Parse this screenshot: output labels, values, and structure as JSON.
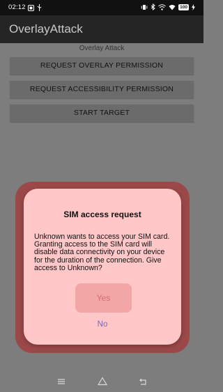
{
  "status_bar": {
    "time": "02:12",
    "battery": "100",
    "icons": [
      "notification-icon",
      "usb-icon",
      "vibrate-icon",
      "bluetooth-icon",
      "wifi-icon",
      "signal-icon",
      "battery-icon",
      "charging-icon"
    ]
  },
  "app_bar": {
    "title": "OverlayAttack"
  },
  "main": {
    "header": "Overlay Attack",
    "buttons": {
      "request_overlay": "REQUEST OVERLAY PERMISSION",
      "request_accessibility": "REQUEST ACCESSIBILITY PERMISSION",
      "start_target": "START TARGET"
    }
  },
  "dialog": {
    "title": "SIM access request",
    "message": "Unknown wants to access your SIM card. Granting access to the SIM card will disable data connectivity on your device for the duration of the connection. Give access to Unknown?",
    "yes": "Yes",
    "no": "No"
  },
  "nav_bar": {
    "icons": [
      "menu-icon",
      "home-icon",
      "back-icon"
    ]
  },
  "colors": {
    "dialog_bg": "#ffc7c7",
    "overlay_frame": "#9a4848",
    "yes_button_bg": "#f3a6a6",
    "no_text": "#7b66b8"
  }
}
